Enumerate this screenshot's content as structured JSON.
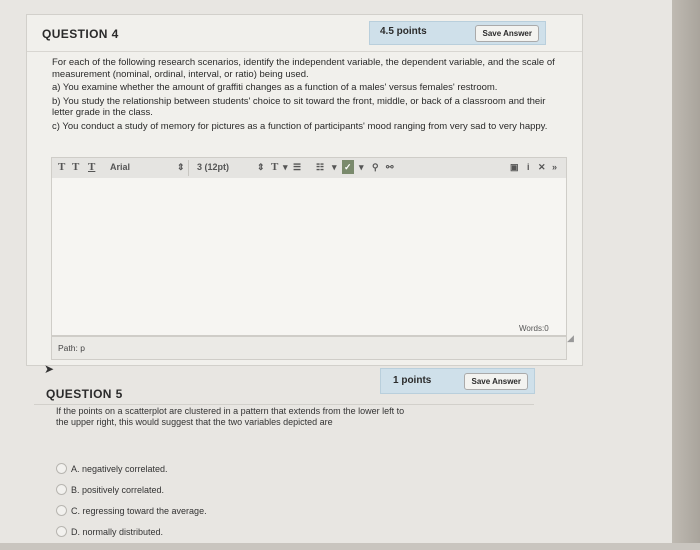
{
  "question4": {
    "title": "QUESTION 4",
    "points": "4.5 points",
    "save_label": "Save Answer",
    "intro": "For each of the following research scenarios, identify the independent variable, the dependent variable, and the scale of measurement (nominal, ordinal, interval, or ratio) being used.",
    "scenario_a": "a) You examine whether the amount of graffiti changes as a function of a males' versus females' restroom.",
    "scenario_b": "b) You study the relationship between students' choice to sit toward the front, middle, or back of a classroom and their letter grade in the class.",
    "scenario_c": "c) You conduct a study of memory for pictures as a function of participants' mood ranging from very sad to very happy.",
    "toolbar": {
      "font_name": "Arial",
      "font_size": "3 (12pt)"
    },
    "editor_text": "",
    "word_count": "Words:0",
    "path": "Path: p"
  },
  "question5": {
    "title": "QUESTION 5",
    "points": "1 points",
    "save_label": "Save Answer",
    "prompt": "If the points on a scatterplot are clustered in a pattern that extends from the lower left to the upper right, this would suggest that the two variables depicted are",
    "options": [
      {
        "label": "A. negatively correlated."
      },
      {
        "label": "B. positively correlated."
      },
      {
        "label": "C. regressing toward the average."
      },
      {
        "label": "D. normally distributed."
      }
    ]
  },
  "colors": {
    "page_bg": "#e8e6e2",
    "points_box": "#cfe0ea",
    "editor_bg": "#f6f5f2"
  }
}
